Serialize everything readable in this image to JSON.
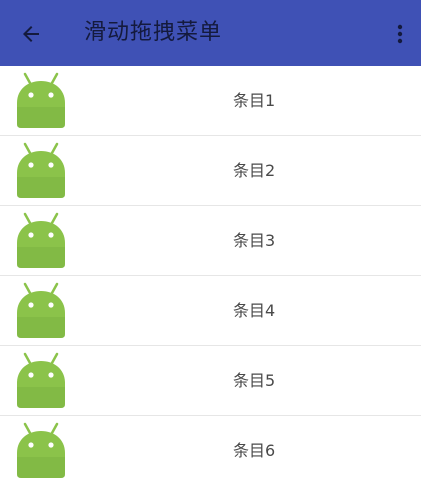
{
  "appbar": {
    "title": "滑动拖拽菜单",
    "back_icon": "arrow-back-icon",
    "menu_icon": "more-vert-icon",
    "color": "#3f51b5"
  },
  "list": {
    "icon": "android-robot-icon",
    "icon_color": "#8bc34a",
    "items": [
      {
        "label": "条目1"
      },
      {
        "label": "条目2"
      },
      {
        "label": "条目3"
      },
      {
        "label": "条目4"
      },
      {
        "label": "条目5"
      },
      {
        "label": "条目6"
      }
    ]
  }
}
